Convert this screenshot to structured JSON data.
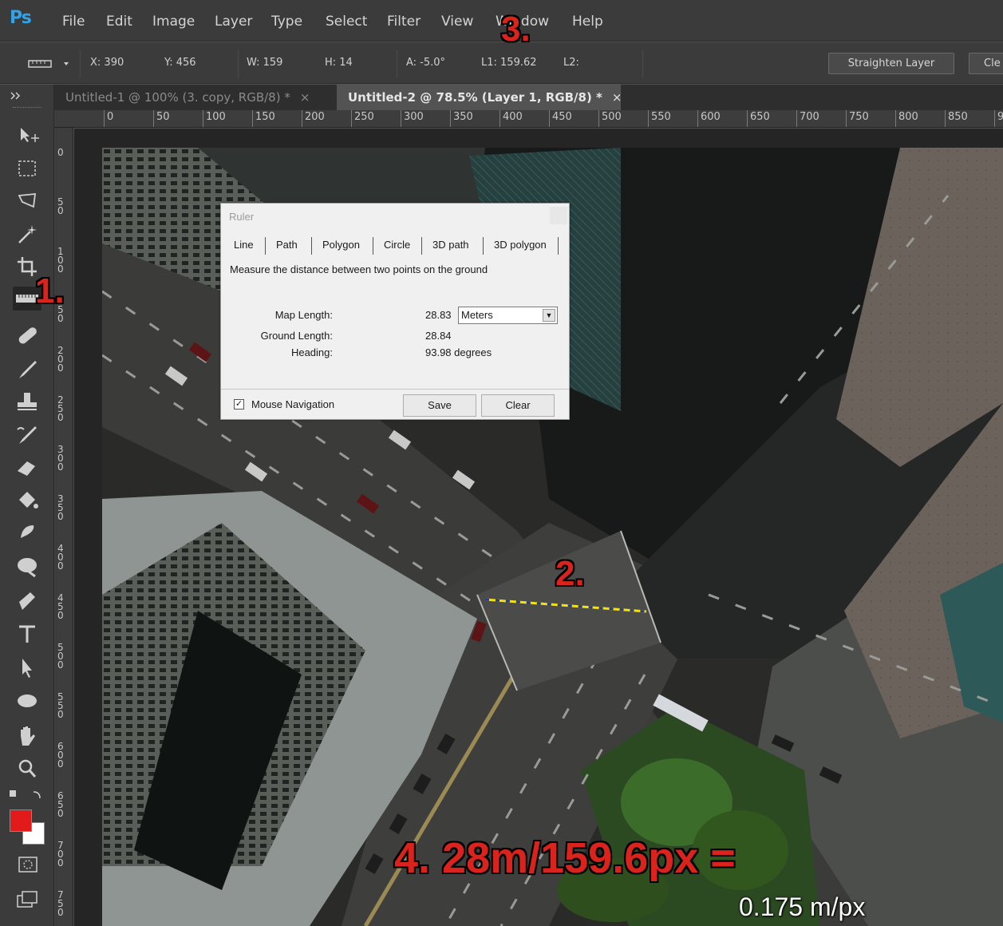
{
  "app": {
    "logo": "Ps"
  },
  "menu": [
    "File",
    "Edit",
    "Image",
    "Layer",
    "Type",
    "Select",
    "Filter",
    "View",
    "Window",
    "Help"
  ],
  "options": {
    "tool_icon": "ruler-icon",
    "x": "X: 390",
    "y": "Y: 456",
    "w": "W: 159",
    "h": "H: 14",
    "a": "A: -5.0°",
    "l1": "L1: 159.62",
    "l2": "L2:",
    "straighten_label": "Straighten Layer",
    "clear_label": "Cle"
  },
  "tabs": [
    {
      "label": "Untitled-1 @ 100% (3. copy, RGB/8) *",
      "close": "×"
    },
    {
      "label": "Untitled-2 @ 78.5% (Layer 1, RGB/8) *",
      "close": "×"
    }
  ],
  "ruler_top": [
    "0",
    "50",
    "100",
    "150",
    "200",
    "250",
    "300",
    "350",
    "400",
    "450",
    "500",
    "550",
    "600",
    "650",
    "700",
    "750",
    "800",
    "850",
    "9"
  ],
  "ruler_left": [
    "0",
    "50",
    "100",
    "150",
    "200",
    "250",
    "300",
    "350",
    "400",
    "450",
    "500",
    "550",
    "600",
    "650",
    "700",
    "750"
  ],
  "toolbar": [
    "move-tool-icon",
    "marquee-icon",
    "lasso-icon",
    "magic-wand-icon",
    "crop-icon",
    "ruler-icon",
    "spot-healing-icon",
    "brush-icon",
    "stamp-icon",
    "history-brush-icon",
    "eraser-icon",
    "paint-bucket-icon",
    "smudge-icon",
    "dodge-icon",
    "pen-icon",
    "type-icon",
    "path-selection-icon",
    "ellipse-icon",
    "hand-icon",
    "zoom-icon"
  ],
  "colors": {
    "foreground": "#e21a1a",
    "background": "#ffffff",
    "accent": "#32a3e8",
    "annotation": "#d9231c"
  },
  "dialog": {
    "title": "Ruler",
    "tabs": [
      "Line",
      "Path",
      "Polygon",
      "Circle",
      "3D path",
      "3D polygon"
    ],
    "description": "Measure the distance between two points on the ground",
    "map_length_label": "Map Length:",
    "map_length_value": "28.83",
    "unit": "Meters",
    "ground_length_label": "Ground Length:",
    "ground_length_value": "28.84",
    "heading_label": "Heading:",
    "heading_value": "93.98 degrees",
    "mouse_nav_label": "Mouse Navigation",
    "mouse_nav_checked": true,
    "save_label": "Save",
    "clear_label": "Clear"
  },
  "annotations": {
    "step1": "1.",
    "step2": "2.",
    "step3": "3.",
    "step4": "4. 28m/159.6px =",
    "result": "0.175 m/px"
  }
}
